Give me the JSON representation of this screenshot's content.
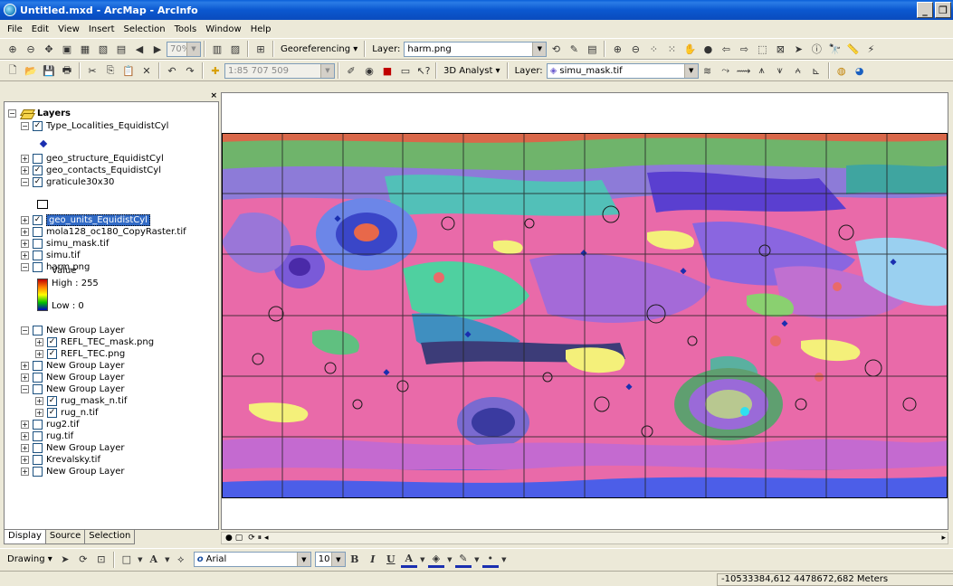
{
  "window": {
    "title": "Untitled.mxd - ArcMap - ArcInfo"
  },
  "menu": [
    "File",
    "Edit",
    "View",
    "Insert",
    "Selection",
    "Tools",
    "Window",
    "Help"
  ],
  "toolbar1": {
    "zoom_value": "70%",
    "georeferencing_label": "Georeferencing",
    "layer_label": "Layer:",
    "layer_value": "harm.png"
  },
  "toolbar2": {
    "scale_value": "1:85 707 509",
    "analyst_label": "3D Analyst",
    "layer_label": "Layer:",
    "layer_value": "simu_mask.tif"
  },
  "toc": {
    "root": "Layers",
    "items": [
      {
        "label": "Type_Localities_EquidistCyl",
        "checked": true,
        "expander": "-"
      },
      {
        "label": "geo_structure_EquidistCyl",
        "checked": false,
        "expander": "+"
      },
      {
        "label": "geo_contacts_EquidistCyl",
        "checked": true,
        "expander": "+"
      },
      {
        "label": "graticule30x30",
        "checked": true,
        "expander": "-"
      },
      {
        "label": "geo_units_EquidistCyl",
        "checked": true,
        "expander": "+"
      },
      {
        "label": "mola128_oc180_CopyRaster.tif",
        "checked": false,
        "expander": "+"
      },
      {
        "label": "simu_mask.tif",
        "checked": false,
        "expander": "+"
      },
      {
        "label": "simu.tif",
        "checked": false,
        "expander": "+"
      },
      {
        "label": "harm.png",
        "checked": false,
        "expander": "-"
      },
      {
        "label": "New Group Layer",
        "checked": false,
        "expander": "-"
      },
      {
        "label": "REFL_TEC_mask.png",
        "checked": true,
        "expander": "+"
      },
      {
        "label": "REFL_TEC.png",
        "checked": true,
        "expander": "+"
      },
      {
        "label": "New Group Layer",
        "checked": false,
        "expander": "+"
      },
      {
        "label": "New Group Layer",
        "checked": false,
        "expander": "+"
      },
      {
        "label": "New Group Layer",
        "checked": false,
        "expander": "-"
      },
      {
        "label": "rug_mask_n.tif",
        "checked": true,
        "expander": "+"
      },
      {
        "label": "rug_n.tif",
        "checked": true,
        "expander": "+"
      },
      {
        "label": "rug2.tif",
        "checked": false,
        "expander": "+"
      },
      {
        "label": "rug.tif",
        "checked": false,
        "expander": "+"
      },
      {
        "label": "New Group Layer",
        "checked": false,
        "expander": "+"
      },
      {
        "label": "Krevalsky.tif",
        "checked": false,
        "expander": "+"
      },
      {
        "label": "New Group Layer",
        "checked": false,
        "expander": "+"
      }
    ],
    "legend_value": "Value",
    "legend_high": "High : 255",
    "legend_low": "Low : 0",
    "tabs": [
      "Display",
      "Source",
      "Selection"
    ]
  },
  "drawing": {
    "label": "Drawing",
    "font_name": "Arial",
    "font_size": "10"
  },
  "status": {
    "coords": "-10533384,612  4478672,682 Meters"
  },
  "colors": {
    "title_bar": "#0b58d0",
    "selection": "#316ac5",
    "map_pink": "#e96aa9",
    "map_purple": "#7a5ad8",
    "map_blue": "#4c5ee8"
  }
}
